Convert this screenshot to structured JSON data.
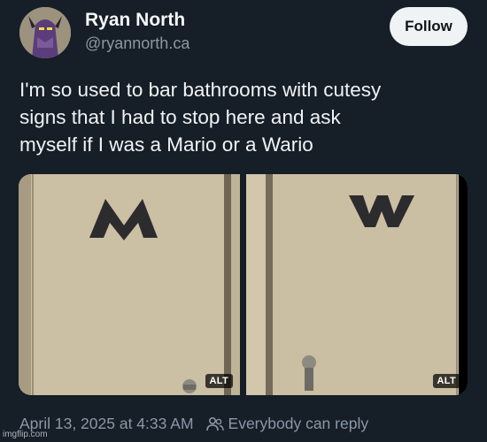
{
  "author": {
    "name": "Ryan North",
    "handle": "@ryannorth.ca"
  },
  "follow_label": "Follow",
  "post": {
    "lines": [
      "I'm so used to bar bathrooms with cutesy",
      "signs that I had to stop here and ask",
      "myself if I was a Mario or a Wario"
    ]
  },
  "media": [
    {
      "sign_letter": "M",
      "alt_label": "ALT"
    },
    {
      "sign_letter": "W",
      "alt_label": "ALT"
    }
  ],
  "footer": {
    "timestamp": "April 13, 2025 at 4:33 AM",
    "reply_setting": "Everybody can reply"
  },
  "watermark": "imgflip.com",
  "colors": {
    "background": "#161e27",
    "follow_button": "#eff3f4",
    "secondary_text": "#8b98a5",
    "door": "#c8bb9f"
  },
  "icons": [
    "avatar-image",
    "people-icon"
  ]
}
